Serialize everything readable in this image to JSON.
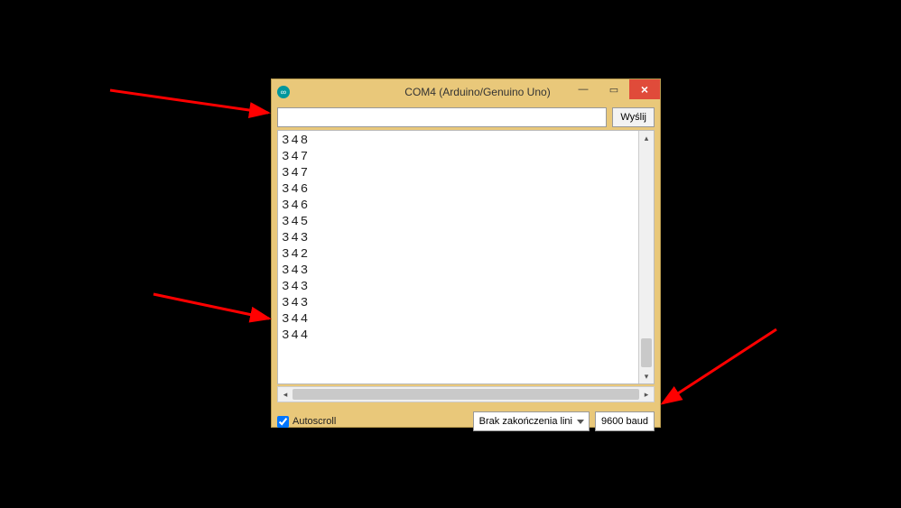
{
  "titlebar": {
    "title": "COM4 (Arduino/Genuino Uno)",
    "close_glyph": "×",
    "min_glyph": "—",
    "max_glyph": "▭"
  },
  "toolbar": {
    "send_label": "Wyślij"
  },
  "output": {
    "lines": [
      "348",
      "347",
      "347",
      "346",
      "346",
      "345",
      "343",
      "342",
      "343",
      "343",
      "343",
      "344",
      "344"
    ]
  },
  "footer": {
    "autoscroll_label": "Autoscroll",
    "autoscroll_checked": true,
    "line_ending_label": "Brak zakończenia lini",
    "baud_label": "9600 baud"
  },
  "arrows": {
    "color": "#ff0000"
  }
}
